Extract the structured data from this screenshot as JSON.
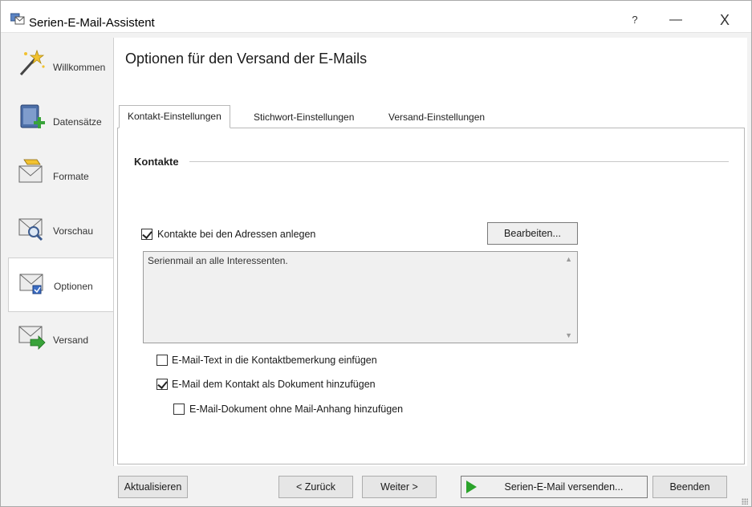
{
  "window": {
    "title": "Serien-E-Mail-Assistent",
    "help_glyph": "?",
    "minimize_glyph": "—",
    "close_glyph": "X"
  },
  "sidebar": {
    "items": [
      {
        "label": "Willkommen",
        "icon": "magic-wand-icon"
      },
      {
        "label": "Datensätze",
        "icon": "database-icon"
      },
      {
        "label": "Formate",
        "icon": "format-mail-icon"
      },
      {
        "label": "Vorschau",
        "icon": "preview-mail-icon"
      },
      {
        "label": "Optionen",
        "icon": "options-mail-icon",
        "active": true
      },
      {
        "label": "Versand",
        "icon": "send-mail-icon"
      }
    ]
  },
  "main": {
    "title": "Optionen für den Versand der E-Mails",
    "tabs": [
      {
        "label": "Kontakt-Einstellungen",
        "active": true
      },
      {
        "label": "Stichwort-Einstellungen"
      },
      {
        "label": "Versand-Einstellungen"
      }
    ],
    "group_title": "Kontakte",
    "create_contacts": {
      "label": "Kontakte bei den Adressen anlegen",
      "checked": true
    },
    "edit_button": "Bearbeiten...",
    "note_text": "Serienmail an alle Interessenten.",
    "insert_text": {
      "label": "E-Mail-Text in die Kontaktbemerkung einfügen",
      "checked": false
    },
    "add_document": {
      "label": "E-Mail dem Kontakt als Dokument hinzufügen",
      "checked": true
    },
    "no_attachment": {
      "label": "E-Mail-Dokument ohne Mail-Anhang hinzufügen",
      "checked": false
    }
  },
  "footer": {
    "refresh": "Aktualisieren",
    "back": "< Zurück",
    "next": "Weiter >",
    "send": "Serien-E-Mail versenden...",
    "finish": "Beenden"
  },
  "colors": {
    "accent_green": "#2aa32a",
    "window_bg": "#f2f2f2"
  }
}
